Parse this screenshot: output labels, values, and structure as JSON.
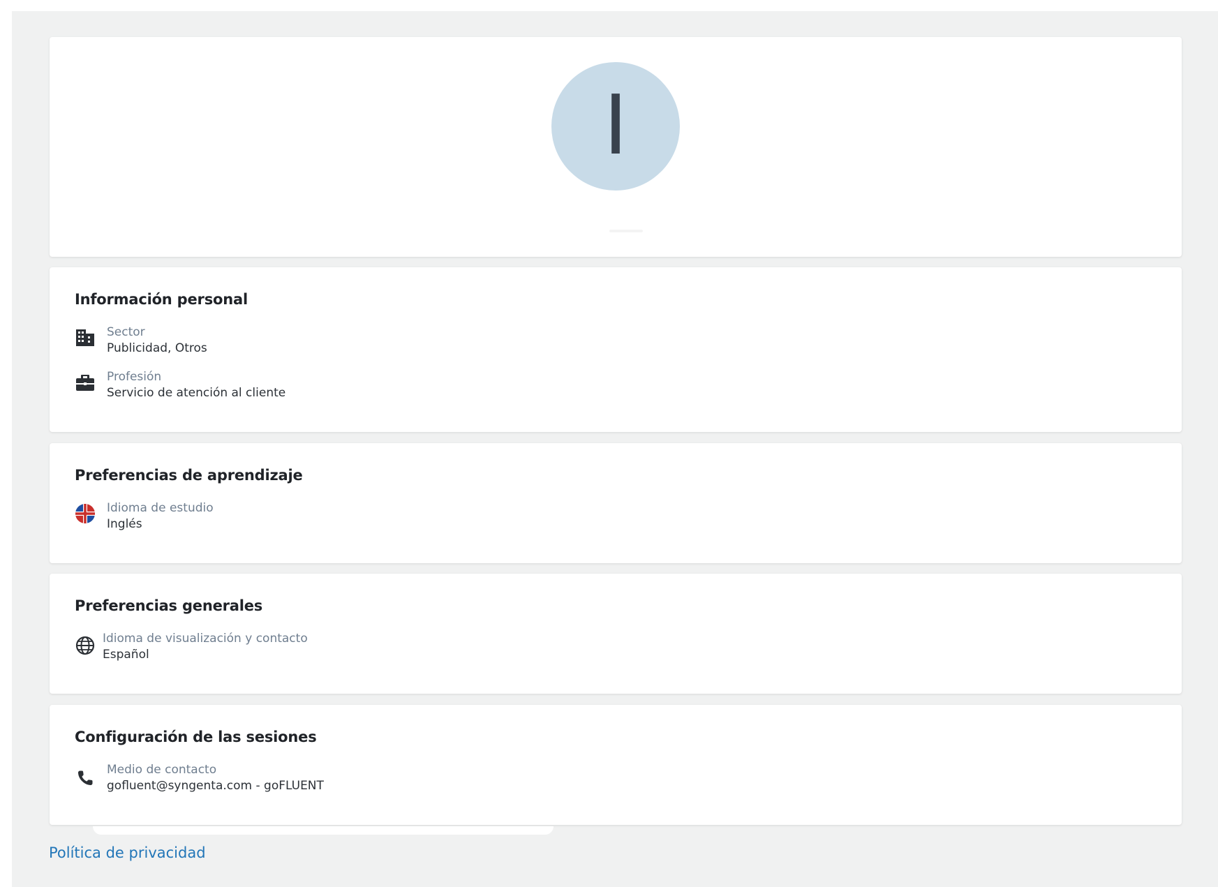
{
  "avatar": {
    "initial": "I"
  },
  "personal_info": {
    "title": "Información personal",
    "items": [
      {
        "icon": "building-icon",
        "label": "Sector",
        "value": "Publicidad, Otros"
      },
      {
        "icon": "briefcase-icon",
        "label": "Profesión",
        "value": "Servicio de atención al cliente"
      }
    ]
  },
  "learning_preferences": {
    "title": "Preferencias de aprendizaje",
    "items": [
      {
        "icon": "uk-flag-icon",
        "label": "Idioma de estudio",
        "value": "Inglés"
      }
    ]
  },
  "general_preferences": {
    "title": "Preferencias generales",
    "items": [
      {
        "icon": "globe-icon",
        "label": "Idioma de visualización y contacto",
        "value": "Español"
      }
    ]
  },
  "session_settings": {
    "title": "Configuración de las sesiones",
    "items": [
      {
        "icon": "phone-icon",
        "label": "Medio de contacto",
        "value": "gofluent@syngenta.com - goFLUENT"
      }
    ]
  },
  "footer": {
    "privacy_link": "Política de privacidad"
  }
}
